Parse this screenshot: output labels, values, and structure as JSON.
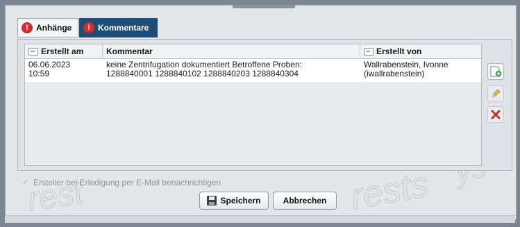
{
  "tabs": [
    {
      "label": "Anhänge",
      "icon": "alert-icon",
      "active": false
    },
    {
      "label": "Kommentare",
      "icon": "alert-icon",
      "active": true
    }
  ],
  "table": {
    "columns": [
      "Erstellt am",
      "Kommentar",
      "Erstellt von"
    ],
    "rows": [
      {
        "date": "06.06.2023",
        "time": "10:59",
        "comment_line1": "keine Zentrifugation dokumentiert Betroffene Proben:",
        "comment_line2": "1288840001 1288840102 1288840203 1288840304",
        "author_line1": "Wallrabenstein, Ivonne",
        "author_line2": "(iwallrabenstein)"
      }
    ]
  },
  "side_tools": [
    {
      "name": "add-comment",
      "icon": "add-note-icon"
    },
    {
      "name": "edit-comment",
      "icon": "pencil-icon"
    },
    {
      "name": "delete-comment",
      "icon": "close-icon"
    }
  ],
  "notify_label": "Ersteller bei Erledigung per E-Mail benachrichtigen",
  "buttons": {
    "save_label": "Speichern",
    "cancel_label": "Abbrechen"
  },
  "colors": {
    "active_tab": "#1e4e78",
    "alert": "#d0312d",
    "delete": "#c9302c",
    "add": "#3aa14a"
  }
}
